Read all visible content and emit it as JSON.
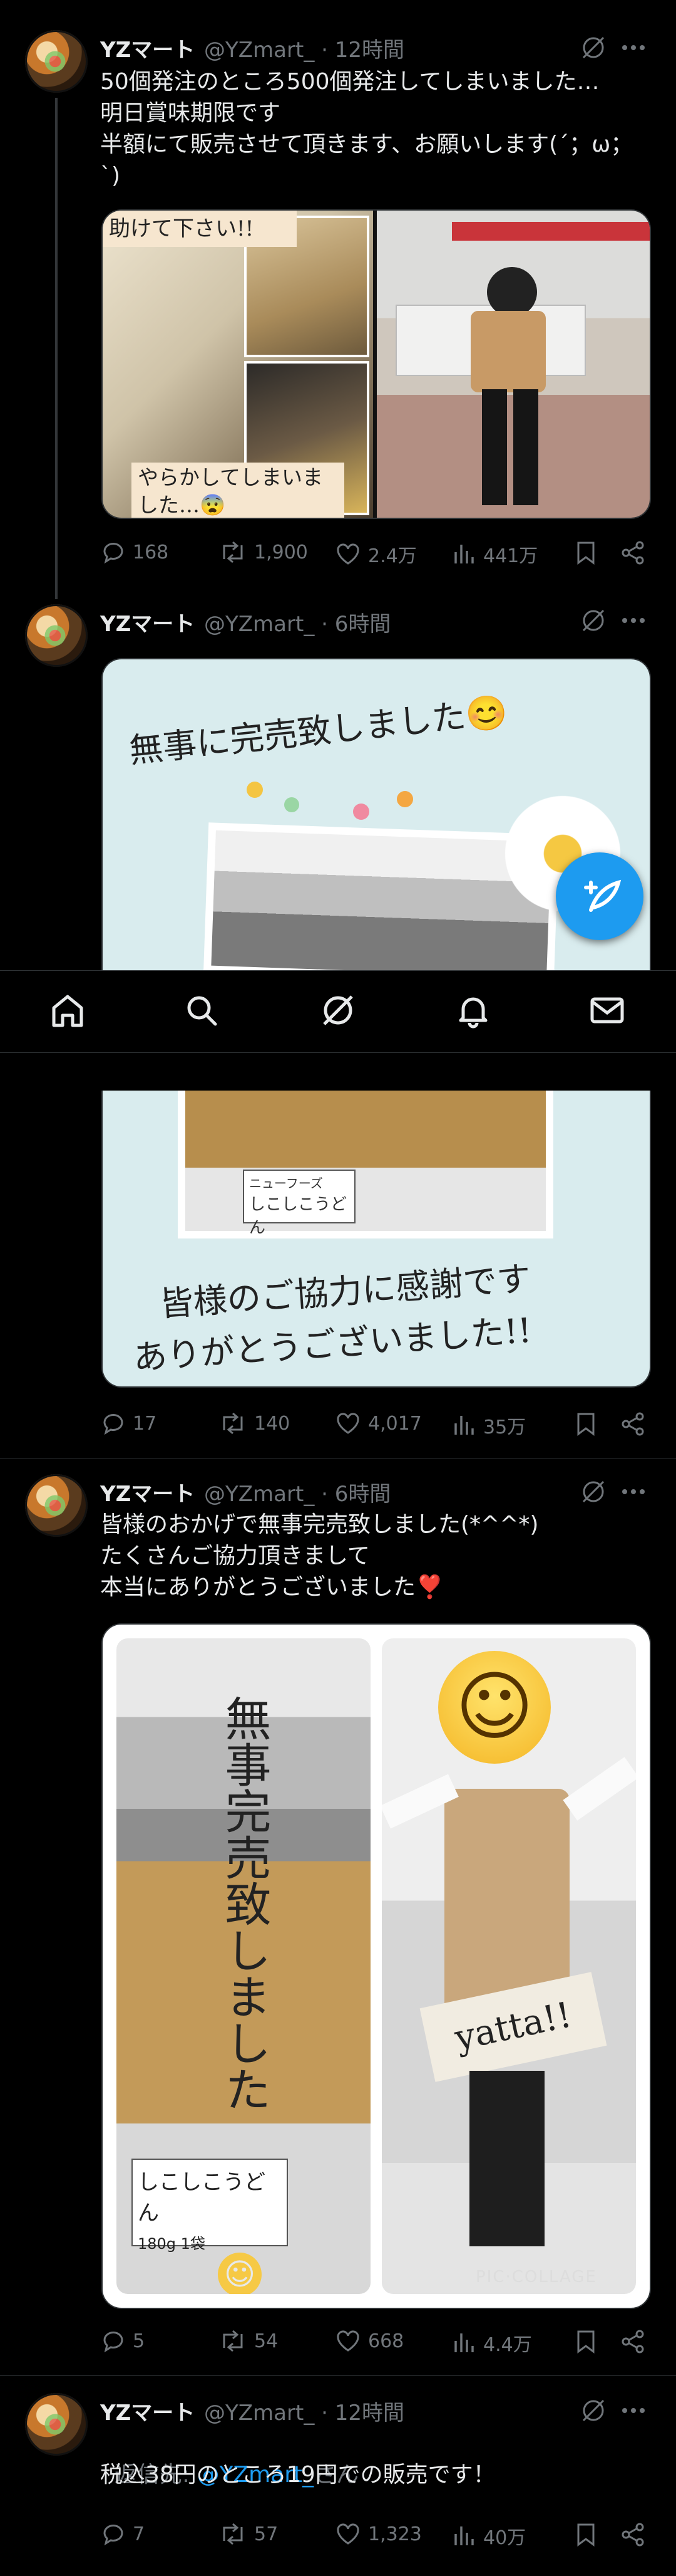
{
  "tweets": [
    {
      "name": "YZマート",
      "handle": "@YZmart_",
      "time": "· 12時間",
      "lines": [
        "50個発注のところ500個発注してしまいました…",
        "明日賞味期限です",
        "半額にて販売させて頂きます、お願いします(´；ω；",
        "`)"
      ],
      "media_caption_top": "助けて下さい!!",
      "media_caption_bottom": "やらかしてしまいました…😨",
      "stats": {
        "replies": "168",
        "retweets": "1,900",
        "likes": "2.4万",
        "views": "441万"
      }
    },
    {
      "name": "YZマート",
      "handle": "@YZmart_",
      "time": "· 6時間",
      "media_caption_top": "無事に完売致しました😊",
      "media_caption_bottom_1": "皆様のご協力に感謝です",
      "media_caption_bottom_2": "ありがとうございました!!",
      "price_label": "ニューフーズ",
      "product_label": "しこしこうどん",
      "stats": {
        "replies": "17",
        "retweets": "140",
        "likes": "4,017",
        "views": "35万"
      }
    },
    {
      "name": "YZマート",
      "handle": "@YZmart_",
      "time": "· 6時間",
      "lines": [
        "皆様のおかげで無事完売致しました(*^^*)",
        "たくさんご協力頂きまして",
        "本当にありがとうございました❣️"
      ],
      "media_vertical": "無事完売致しました",
      "media_yatta": "yatta!!",
      "media_watermark": "PIC·COLLAGE",
      "product_label": "しこしこうどん",
      "product_sub": "180g 1袋",
      "stats": {
        "replies": "5",
        "retweets": "54",
        "likes": "668",
        "views": "4.4万"
      }
    },
    {
      "name": "YZマート",
      "handle": "@YZmart_",
      "time": "· 12時間",
      "reply_prefix": "返信先: ",
      "reply_handle": "@YZmart_",
      "reply_suffix": "さん",
      "lines": [
        "税込38円のところ19円での販売です！"
      ],
      "stats": {
        "replies": "7",
        "retweets": "57",
        "likes": "1,323",
        "views": "40万"
      }
    }
  ],
  "nav": {
    "items": [
      "home-icon",
      "search-icon",
      "grok-icon",
      "notifications-icon",
      "messages-icon"
    ]
  },
  "fab": {
    "icon": "compose-icon"
  },
  "colors": {
    "background": "#000000",
    "text": "#e7e9ea",
    "muted": "#71767b",
    "accent": "#1d9bf0",
    "divider": "#2f3336"
  }
}
